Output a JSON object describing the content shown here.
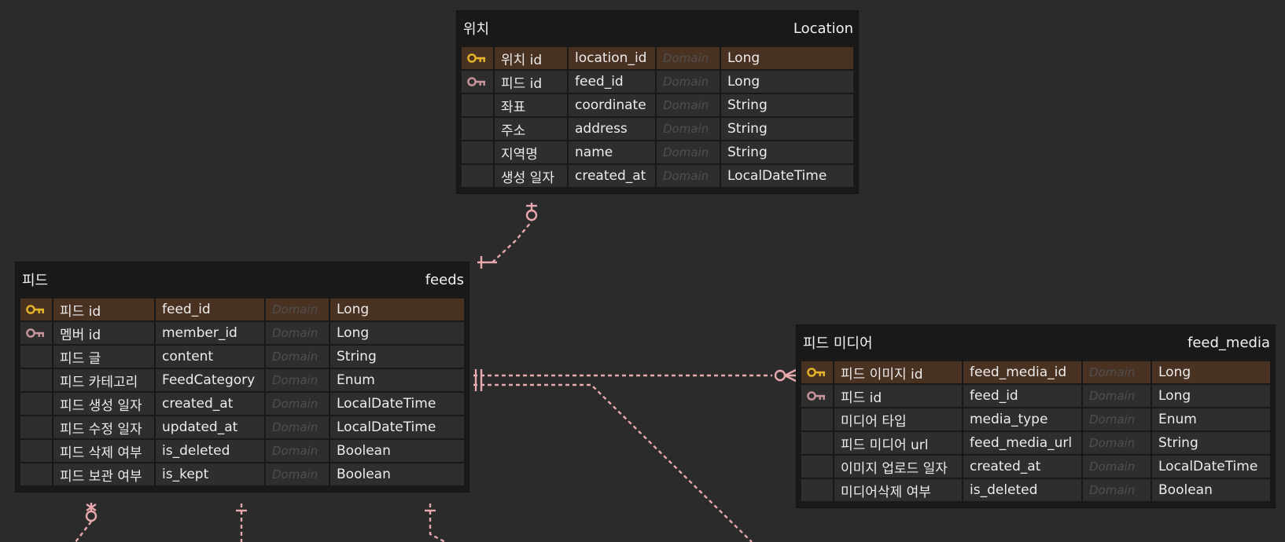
{
  "entities": {
    "location": {
      "logical_name": "위치",
      "physical_name": "Location",
      "columns": [
        {
          "key": "pk",
          "key_icon": "primary-key-icon",
          "logical": "위치 id",
          "physical": "location_id",
          "domain": "Domain",
          "type": "Long"
        },
        {
          "key": "fk",
          "key_icon": "foreign-key-icon",
          "logical": "피드 id",
          "physical": "feed_id",
          "domain": "Domain",
          "type": "Long"
        },
        {
          "key": "",
          "logical": "좌표",
          "physical": "coordinate",
          "domain": "Domain",
          "type": "String"
        },
        {
          "key": "",
          "logical": "주소",
          "physical": "address",
          "domain": "Domain",
          "type": "String"
        },
        {
          "key": "",
          "logical": "지역명",
          "physical": "name",
          "domain": "Domain",
          "type": "String"
        },
        {
          "key": "",
          "logical": "생성 일자",
          "physical": "created_at",
          "domain": "Domain",
          "type": "LocalDateTime"
        }
      ]
    },
    "feeds": {
      "logical_name": "피드",
      "physical_name": "feeds",
      "columns": [
        {
          "key": "pk",
          "key_icon": "primary-key-icon",
          "logical": "피드 id",
          "physical": "feed_id",
          "domain": "Domain",
          "type": "Long"
        },
        {
          "key": "fk",
          "key_icon": "foreign-key-icon",
          "logical": "멤버 id",
          "physical": "member_id",
          "domain": "Domain",
          "type": "Long"
        },
        {
          "key": "",
          "logical": "피드 글",
          "physical": "content",
          "domain": "Domain",
          "type": "String"
        },
        {
          "key": "",
          "logical": "피드 카테고리",
          "physical": "FeedCategory",
          "domain": "Domain",
          "type": "Enum"
        },
        {
          "key": "",
          "logical": "피드 생성 일자",
          "physical": "created_at",
          "domain": "Domain",
          "type": "LocalDateTime"
        },
        {
          "key": "",
          "logical": "피드 수정 일자",
          "physical": "updated_at",
          "domain": "Domain",
          "type": "LocalDateTime"
        },
        {
          "key": "",
          "logical": "피드 삭제 여부",
          "physical": "is_deleted",
          "domain": "Domain",
          "type": "Boolean"
        },
        {
          "key": "",
          "logical": "피드 보관 여부",
          "physical": "is_kept",
          "domain": "Domain",
          "type": "Boolean"
        }
      ]
    },
    "feed_media": {
      "logical_name": "피드 미디어",
      "physical_name": "feed_media",
      "columns": [
        {
          "key": "pk",
          "key_icon": "primary-key-icon",
          "logical": "피드 이미지 id",
          "physical": "feed_media_id",
          "domain": "Domain",
          "type": "Long"
        },
        {
          "key": "fk",
          "key_icon": "foreign-key-icon",
          "logical": "피드 id",
          "physical": "feed_id",
          "domain": "Domain",
          "type": "Long"
        },
        {
          "key": "",
          "logical": "미디어 타입",
          "physical": "media_type",
          "domain": "Domain",
          "type": "Enum"
        },
        {
          "key": "",
          "logical": "피드 미디어 url",
          "physical": "feed_media_url",
          "domain": "Domain",
          "type": "String"
        },
        {
          "key": "",
          "logical": "이미지 업로드 일자",
          "physical": "created_at",
          "domain": "Domain",
          "type": "LocalDateTime"
        },
        {
          "key": "",
          "logical": "미디어삭제 여부",
          "physical": "is_deleted",
          "domain": "Domain",
          "type": "Boolean"
        }
      ]
    }
  },
  "colors": {
    "background": "#2b2b2b",
    "entity_body": "#191919",
    "cell": "#2e2e2e",
    "pk_row": "#4a3222",
    "pk_key": "#e8b52a",
    "fk_key": "#c7959b",
    "relationship_line": "#e8a9ae",
    "domain_text": "#4f4f4f"
  }
}
